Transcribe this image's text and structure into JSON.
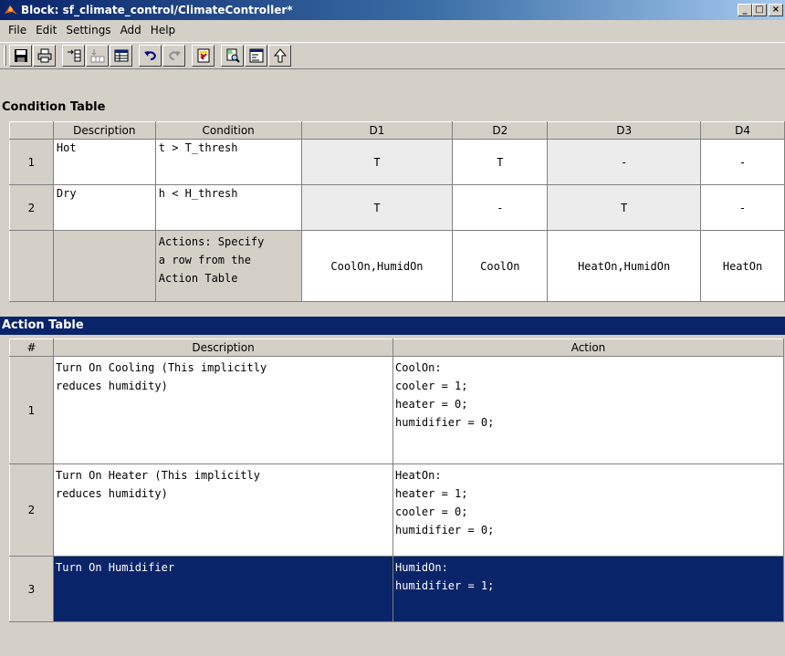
{
  "window": {
    "title": "Block: sf_climate_control/ClimateController*",
    "controls": {
      "minimize": "_",
      "maximize": "□",
      "close": "×"
    }
  },
  "menu": [
    "File",
    "Edit",
    "Settings",
    "Add",
    "Help"
  ],
  "toolbar": {
    "buttons": [
      "save-icon",
      "print-icon",
      "add-row-icon",
      "add-column-icon",
      "table-icon",
      "undo-icon",
      "redo-icon",
      "check-icon",
      "search-icon",
      "code-icon",
      "up-arrow-icon"
    ]
  },
  "condition_table": {
    "title": "Condition Table",
    "headers": {
      "description": "Description",
      "condition": "Condition",
      "d1": "D1",
      "d2": "D2",
      "d3": "D3",
      "d4": "D4"
    },
    "rows": [
      {
        "num": "1",
        "description": "Hot",
        "condition": "t > T_thresh",
        "d1": "T",
        "d2": "T",
        "d3": "-",
        "d4": "-"
      },
      {
        "num": "2",
        "description": "Dry",
        "condition": "h < H_thresh",
        "d1": "T",
        "d2": "-",
        "d3": "T",
        "d4": "-"
      }
    ],
    "actions_row": {
      "label": "Actions: Specify\na row from the\nAction Table",
      "d1": "CoolOn,HumidOn",
      "d2": "CoolOn",
      "d3": "HeatOn,HumidOn",
      "d4": "HeatOn"
    }
  },
  "action_table": {
    "title": "Action Table",
    "headers": {
      "num": "#",
      "description": "Description",
      "action": "Action"
    },
    "rows": [
      {
        "num": "1",
        "description": "Turn On Cooling (This implicitly\nreduces humidity)",
        "action": "CoolOn:\ncooler = 1;\nheater = 0;\nhumidifier = 0;"
      },
      {
        "num": "2",
        "description": "Turn On Heater (This implicitly\nreduces humidity)",
        "action": "HeatOn:\nheater = 1;\ncooler = 0;\nhumidifier = 0;"
      },
      {
        "num": "3",
        "description": "Turn On Humidifier",
        "action": "HumidOn:\nhumidifier = 1;"
      }
    ],
    "selected_row": "3"
  }
}
